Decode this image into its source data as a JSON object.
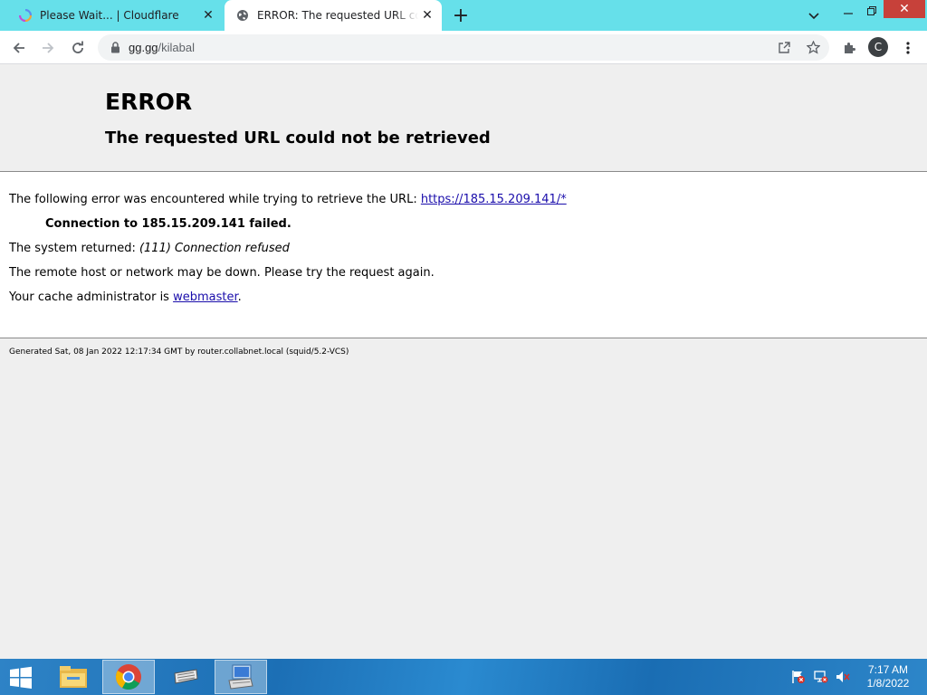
{
  "browser": {
    "tabs": [
      {
        "title": "Please Wait... | Cloudflare",
        "icon": "loading-icon",
        "active": false
      },
      {
        "title": "ERROR: The requested URL could not be retrieved",
        "icon": "globe-icon",
        "active": true
      }
    ],
    "url_host": "gg.gg",
    "url_path": "/kilabal",
    "profile_initial": "C"
  },
  "page": {
    "title": "ERROR",
    "subtitle": "The requested URL could not be retrieved",
    "intro_text": "The following error was encountered while trying to retrieve the URL: ",
    "intro_link": "https://185.15.209.141/*",
    "connection_msg": "Connection to 185.15.209.141 failed.",
    "system_returned_label": "The system returned: ",
    "system_returned_value": "(111) Connection refused",
    "remote_msg": "The remote host or network may be down. Please try the request again.",
    "cache_admin_text": "Your cache administrator is ",
    "cache_admin_link": "webmaster",
    "cache_admin_suffix": ".",
    "footer": "Generated Sat, 08 Jan 2022 12:17:34 GMT by router.collabnet.local (squid/5.2-VCS)"
  },
  "taskbar": {
    "time": "7:17 AM",
    "date": "1/8/2022",
    "apps": [
      "file-explorer-icon",
      "chrome-icon",
      "keyboard-icon",
      "remote-desktop-icon"
    ]
  },
  "colors": {
    "tabstrip": "#66e0ea",
    "link": "#1a0dab",
    "close_button": "#c7413a",
    "taskbar": "#1f74b8"
  }
}
